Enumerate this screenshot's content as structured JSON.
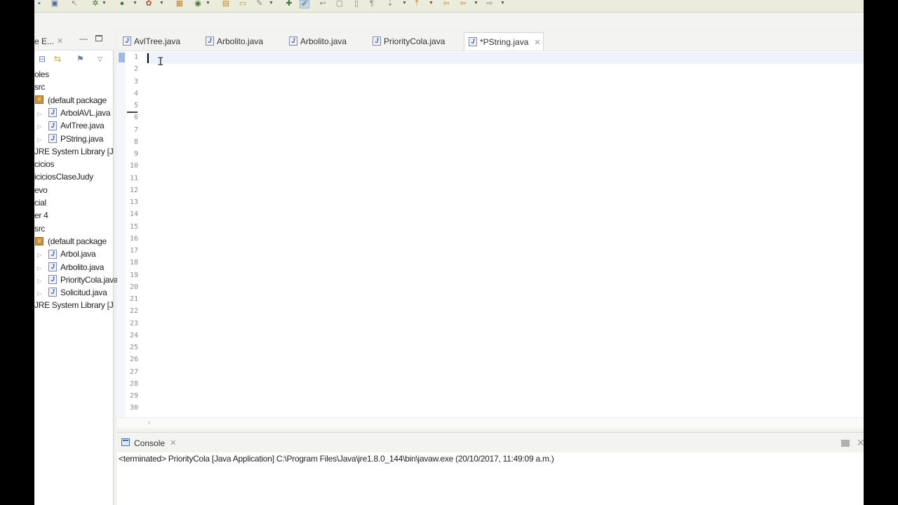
{
  "explorer": {
    "tab_label": "e E...",
    "items": [
      {
        "label": "oles",
        "indent": 0,
        "icon": "none",
        "arrow": false
      },
      {
        "label": "src",
        "indent": 0,
        "icon": "none",
        "arrow": false
      },
      {
        "label": "(default package",
        "indent": 0,
        "icon": "package-icon",
        "arrow": false
      },
      {
        "label": "ArbolAVL.java",
        "indent": 1,
        "icon": "java-file-icon",
        "arrow": true
      },
      {
        "label": "AvlTree.java",
        "indent": 1,
        "icon": "java-file-icon",
        "arrow": true
      },
      {
        "label": "PString.java",
        "indent": 1,
        "icon": "java-file-icon",
        "arrow": true
      },
      {
        "label": "JRE System Library [J",
        "indent": 0,
        "icon": "none",
        "arrow": false
      },
      {
        "label": "cicios",
        "indent": 0,
        "icon": "none",
        "arrow": false
      },
      {
        "label": "iciciosClaseJudy",
        "indent": 0,
        "icon": "none",
        "arrow": false
      },
      {
        "label": "evo",
        "indent": 0,
        "icon": "none",
        "arrow": false
      },
      {
        "label": "cial",
        "indent": 0,
        "icon": "none",
        "arrow": false
      },
      {
        "label": "er 4",
        "indent": 0,
        "icon": "none",
        "arrow": false
      },
      {
        "label": "src",
        "indent": 0,
        "icon": "none",
        "arrow": false
      },
      {
        "label": "(default package",
        "indent": 0,
        "icon": "package-icon",
        "arrow": false
      },
      {
        "label": "Arbol.java",
        "indent": 1,
        "icon": "java-file-icon",
        "arrow": true
      },
      {
        "label": "Arbolito.java",
        "indent": 1,
        "icon": "java-file-icon",
        "arrow": true
      },
      {
        "label": "PriorityCola.java",
        "indent": 1,
        "icon": "java-file-icon",
        "arrow": true
      },
      {
        "label": "Solicitud.java",
        "indent": 1,
        "icon": "java-file-icon",
        "arrow": true
      },
      {
        "label": "JRE System Library [J",
        "indent": 0,
        "icon": "none",
        "arrow": false
      }
    ]
  },
  "editor_tabs": [
    {
      "label": "AvlTree.java",
      "active": false
    },
    {
      "label": "Arbolito.java",
      "active": false
    },
    {
      "label": "Arbolito.java",
      "active": false
    },
    {
      "label": "PriorityCola.java",
      "active": false
    },
    {
      "label": "*PString.java",
      "active": true
    }
  ],
  "editor": {
    "line_numbers": [
      "1",
      "2",
      "3",
      "4",
      "5",
      "6",
      "7",
      "8",
      "9",
      "10",
      "11",
      "12",
      "13",
      "14",
      "15",
      "16",
      "17",
      "18",
      "19",
      "20",
      "21",
      "22",
      "23",
      "24",
      "25",
      "26",
      "27",
      "28",
      "29",
      "30"
    ],
    "cursor_glyph": "I"
  },
  "console": {
    "tab_label": "Console",
    "status": "<terminated> PriorityCola [Java Application] C:\\Program Files\\Java\\jre1.8.0_144\\bin\\javaw.exe (20/10/2017, 11:49:09 a.m.)"
  },
  "glyphs": {
    "close": "✕",
    "minimize": "—",
    "arrow_right": "▷",
    "arrow_left": "‹",
    "chevron_down": "▼"
  },
  "colors": {
    "toolbar_bg": "#ececdc",
    "current_line": "#eef2fb",
    "ruler_mark": "#9fb8e8",
    "package": "#c9933e"
  }
}
